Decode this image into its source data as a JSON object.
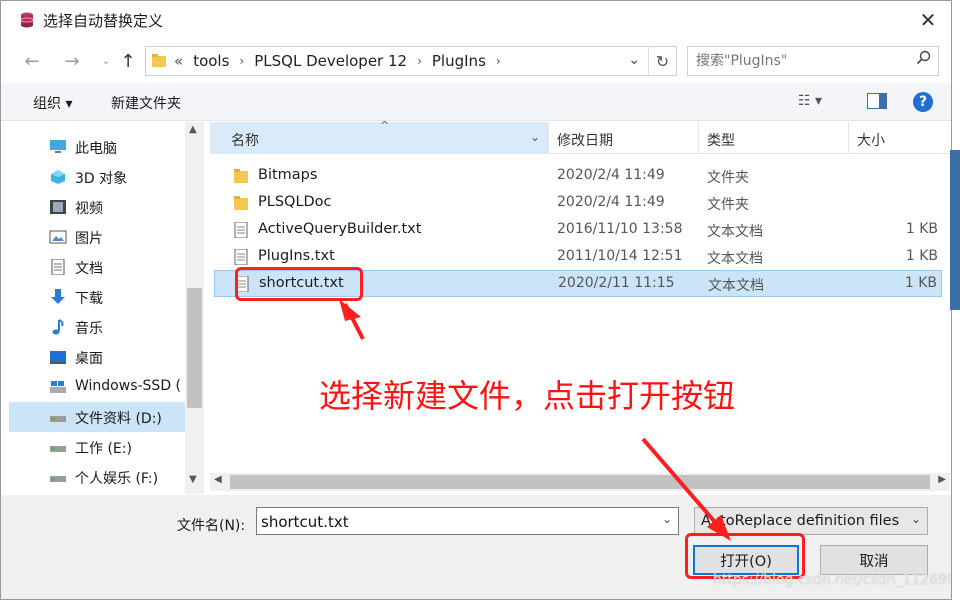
{
  "window": {
    "title": "选择自动替换定义",
    "close_glyph": "✕"
  },
  "nav": {
    "back_glyph": "←",
    "forward_glyph": "→",
    "up_glyph": "↑",
    "breadcrumb_prefix": "«",
    "crumbs": [
      "tools",
      "PLSQL Developer 12",
      "PlugIns"
    ],
    "crumb_sep": "›",
    "dropdown_glyph": "⌄",
    "refresh_glyph": "↻",
    "search_placeholder": "搜索\"PlugIns\"",
    "search_glyph": "⚲"
  },
  "toolbar": {
    "organize_label": "组织 ▾",
    "new_folder_label": "新建文件夹",
    "view_label": "☷ ▾",
    "help_glyph": "?"
  },
  "sidebar": {
    "items": [
      {
        "label": "此电脑",
        "icon": "computer-icon"
      },
      {
        "label": "3D 对象",
        "icon": "cube-icon"
      },
      {
        "label": "视频",
        "icon": "video-icon"
      },
      {
        "label": "图片",
        "icon": "picture-icon"
      },
      {
        "label": "文档",
        "icon": "document-icon"
      },
      {
        "label": "下载",
        "icon": "download-icon"
      },
      {
        "label": "音乐",
        "icon": "music-icon"
      },
      {
        "label": "桌面",
        "icon": "desktop-icon"
      },
      {
        "label": "Windows-SSD (",
        "icon": "drive-icon"
      },
      {
        "label": "文件资料 (D:)",
        "icon": "drive-icon",
        "selected": true
      },
      {
        "label": "工作 (E:)",
        "icon": "drive-icon"
      },
      {
        "label": "个人娱乐 (F:)",
        "icon": "drive-icon"
      }
    ]
  },
  "columns": {
    "name": "名称",
    "modified": "修改日期",
    "type": "类型",
    "size": "大小",
    "sort_glyph": "^"
  },
  "files": [
    {
      "name": "Bitmaps",
      "date": "2020/2/4 11:49",
      "type": "文件夹",
      "size": "",
      "kind": "folder"
    },
    {
      "name": "PLSQLDoc",
      "date": "2020/2/4 11:49",
      "type": "文件夹",
      "size": "",
      "kind": "folder"
    },
    {
      "name": "ActiveQueryBuilder.txt",
      "date": "2016/11/10 13:58",
      "type": "文本文档",
      "size": "1 KB",
      "kind": "text"
    },
    {
      "name": "PlugIns.txt",
      "date": "2011/10/14 12:51",
      "type": "文本文档",
      "size": "1 KB",
      "kind": "text"
    },
    {
      "name": "shortcut.txt",
      "date": "2020/2/11 11:15",
      "type": "文本文档",
      "size": "1 KB",
      "kind": "text",
      "selected": true
    }
  ],
  "annotation_text": "选择新建文件，点击打开按钮",
  "bottom": {
    "filename_label": "文件名(N):",
    "filename_value": "shortcut.txt",
    "filetype_value": "AutoReplace definition files (",
    "open_label": "打开(O)",
    "cancel_label": "取消"
  },
  "watermark": "https://blog.csdn.net/csdn_112699536",
  "colors": {
    "selection": "#cce4f7",
    "annotation_red": "#ff1f1f",
    "accent": "#0078d7",
    "folder": "#f2c94c"
  }
}
